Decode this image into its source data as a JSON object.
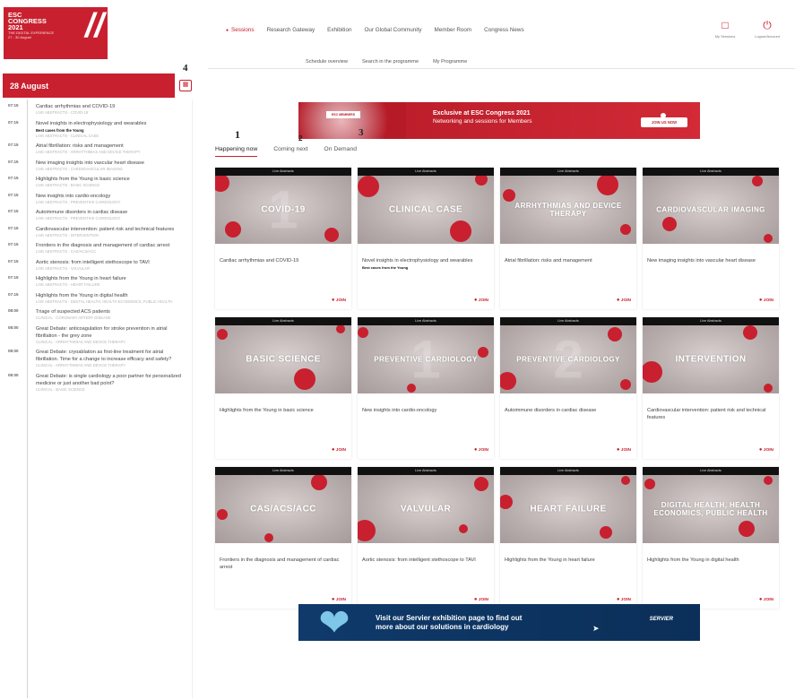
{
  "header": {
    "logo_lines": [
      "ESC",
      "CONGRESS",
      "2021"
    ],
    "logo_sub": "THE DIGITAL EXPERIENCE",
    "logo_dates": "27 - 30 August",
    "nav": [
      "Sessions",
      "Research Gateway",
      "Exhibition",
      "Our Global Community",
      "Member Room",
      "Congress News"
    ],
    "btn_mysessions": "My Sessions",
    "btn_logout": "Logout/Account",
    "subnav": [
      "Schedule overview",
      "Search in the programme",
      "My Programme"
    ]
  },
  "annotations": {
    "n1": "1",
    "n2": "2",
    "n3": "3",
    "n4": "4"
  },
  "sidebar": {
    "date": "28 August",
    "sessions": [
      {
        "time": "07:15",
        "title": "Cardiac arrhythmias and COVID-19",
        "sub": "LIVE ABSTRACTS - COVID-19"
      },
      {
        "time": "07:15",
        "title": "Novel insights in electrophysiology and wearables",
        "bold": "Best cases from the Young",
        "sub": "LIVE ABSTRACTS - CLINICAL CASE"
      },
      {
        "time": "07:15",
        "title": "Atrial fibrillation: risks and management",
        "sub": "LIVE ABSTRACTS - ARRHYTHMIAS AND DEVICE THERAPY"
      },
      {
        "time": "07:15",
        "title": "New imaging insights into vascular heart disease",
        "sub": "LIVE ABSTRACTS - CARDIOVASCULAR IMAGING"
      },
      {
        "time": "07:15",
        "title": "Highlights from the Young in basic science",
        "sub": "LIVE ABSTRACTS - BASIC SCIENCE"
      },
      {
        "time": "07:15",
        "title": "New insights into cardio-oncology",
        "sub": "LIVE ABSTRACTS - PREVENTIVE CARDIOLOGY"
      },
      {
        "time": "07:15",
        "title": "Autoimmune disorders in cardiac disease",
        "sub": "LIVE ABSTRACTS - PREVENTIVE CARDIOLOGY"
      },
      {
        "time": "07:15",
        "title": "Cardiovascular intervention: patient risk and technical features",
        "sub": "LIVE ABSTRACTS - INTERVENTION"
      },
      {
        "time": "07:15",
        "title": "Frontiers in the diagnosis and management of cardiac arrest",
        "sub": "LIVE ABSTRACTS - CAS/ACS/ACC"
      },
      {
        "time": "07:15",
        "title": "Aortic stenosis: from intelligent stethoscope to TAVI",
        "sub": "LIVE ABSTRACTS - VALVULAR"
      },
      {
        "time": "07:15",
        "title": "Highlights from the Young in heart failure",
        "sub": "LIVE ABSTRACTS - HEART FAILURE"
      },
      {
        "time": "07:15",
        "title": "Highlights from the Young in digital health",
        "sub": "LIVE ABSTRACTS - DIGITAL HEALTH, HEALTH ECONOMICS, PUBLIC HEALTH"
      },
      {
        "time": "08:00",
        "title": "Triage of suspected ACS patients",
        "sub": "CLINICAL - CORONARY ARTERY DISEASE"
      },
      {
        "time": "08:00",
        "title": "Great Debate: anticoagulation for stroke prevention in atrial fibrillation - the grey zone",
        "sub": "CLINICAL - ARRHYTHMIAS AND DEVICE THERAPY"
      },
      {
        "time": "08:00",
        "title": "Great Debate: cryoablation as first-line treatment for atrial fibrillation. Time for a change to increase efficacy and safety?",
        "sub": "CLINICAL - ARRHYTHMIAS AND DEVICE THERAPY"
      },
      {
        "time": "08:00",
        "title": "Great Debate: is single cardiology a poor partner for personalized medicine or just another bad point?",
        "sub": "CLINICAL - BASIC SCIENCE"
      }
    ]
  },
  "banner_top": {
    "badge": "ESC MEMBERS",
    "line1": "Exclusive at ESC Congress 2021",
    "line2": "Networking and sessions for Members",
    "button": "JOIN US NOW"
  },
  "tabs": [
    "Happening now",
    "Coming next",
    "On Demand"
  ],
  "cards": [
    {
      "ribbon": "Live Abstracts",
      "label": "COVID-19",
      "title": "Cardiac arrhythmias and COVID-19",
      "bold": "",
      "join": "JOIN"
    },
    {
      "ribbon": "Live Abstracts",
      "label": "CLINICAL CASE",
      "title": "Novel insights in electrophysiology and wearables",
      "bold": "Best cases from the Young",
      "join": "JOIN"
    },
    {
      "ribbon": "Live Abstracts",
      "label": "ARRHYTHMIAS AND DEVICE THERAPY",
      "title": "Atrial fibrillation: risks and management",
      "bold": "",
      "join": "JOIN"
    },
    {
      "ribbon": "Live Abstracts",
      "label": "CARDIOVASCULAR IMAGING",
      "title": "New imaging insights into vascular heart disease",
      "bold": "",
      "join": "JOIN"
    },
    {
      "ribbon": "Live Abstracts",
      "label": "BASIC SCIENCE",
      "title": "Highlights from the Young in basic science",
      "bold": "",
      "join": "JOIN"
    },
    {
      "ribbon": "Live Abstracts",
      "label": "PREVENTIVE CARDIOLOGY",
      "title": "New insights into cardio-oncology",
      "bold": "",
      "join": "JOIN"
    },
    {
      "ribbon": "Live Abstracts",
      "label": "PREVENTIVE CARDIOLOGY",
      "title": "Autoimmune disorders in cardiac disease",
      "bold": "",
      "join": "JOIN"
    },
    {
      "ribbon": "Live Abstracts",
      "label": "INTERVENTION",
      "title": "Cardiovascular intervention: patient risk and technical features",
      "bold": "",
      "join": "JOIN"
    },
    {
      "ribbon": "Live Abstracts",
      "label": "CAS/ACS/ACC",
      "title": "Frontiers in the diagnosis and management of cardiac arrest",
      "bold": "",
      "join": "JOIN"
    },
    {
      "ribbon": "Live Abstracts",
      "label": "VALVULAR",
      "title": "Aortic stenosis: from intelligent stethoscope to TAVI",
      "bold": "",
      "join": "JOIN"
    },
    {
      "ribbon": "Live Abstracts",
      "label": "HEART FAILURE",
      "title": "Highlights from the Young in heart failure",
      "bold": "",
      "join": "JOIN"
    },
    {
      "ribbon": "Live Abstracts",
      "label": "DIGITAL HEALTH, HEALTH ECONOMICS, PUBLIC HEALTH",
      "title": "Highlights from the Young in digital health",
      "bold": "",
      "join": "JOIN"
    }
  ],
  "banner_bottom": {
    "line1": "Visit our Servier exhibition page to find out",
    "line2": "more about our solutions in cardiology",
    "brand": "SERVIER"
  },
  "colors": {
    "accent": "#c8202f",
    "ribbon": "#111111",
    "servier": "#0f3a6b"
  }
}
